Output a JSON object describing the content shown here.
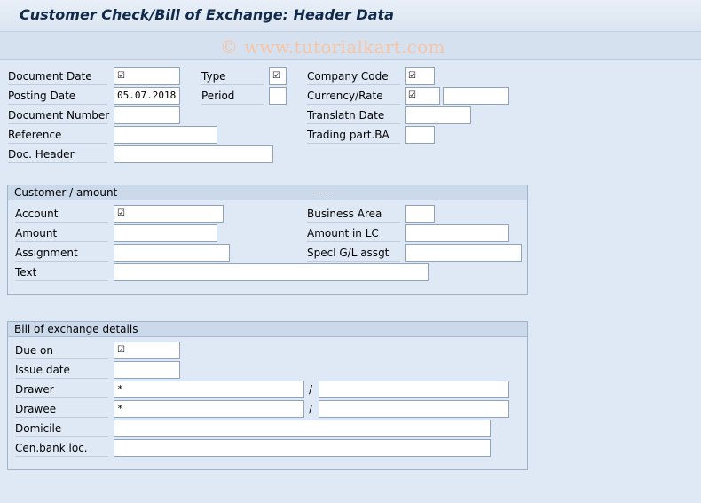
{
  "window": {
    "title": "Customer Check/Bill of Exchange: Header Data"
  },
  "watermark": "© www.tutorialkart.com",
  "header": {
    "document_date_label": "Document Date",
    "posting_date_label": "Posting Date",
    "posting_date_value": "05.07.2018",
    "document_number_label": "Document Number",
    "reference_label": "Reference",
    "doc_header_label": "Doc. Header",
    "type_label": "Type",
    "period_label": "Period",
    "company_code_label": "Company Code",
    "currency_rate_label": "Currency/Rate",
    "translation_date_label": "Translatn Date",
    "trading_part_label": "Trading part.BA",
    "required_mark": "☑"
  },
  "customer_group": {
    "title": "Customer / amount",
    "dashes": "----",
    "account_label": "Account",
    "amount_label": "Amount",
    "assignment_label": "Assignment",
    "text_label": "Text",
    "business_area_label": "Business Area",
    "amount_lc_label": "Amount in LC",
    "special_gl_label": "Specl G/L assgt"
  },
  "boe_group": {
    "title": "Bill of exchange details",
    "due_on_label": "Due on",
    "issue_date_label": "Issue date",
    "drawer_label": "Drawer",
    "drawer_value": "*",
    "drawee_label": "Drawee",
    "drawee_value": "*",
    "domicile_label": "Domicile",
    "cen_bank_label": "Cen.bank loc.",
    "separator": "/"
  }
}
